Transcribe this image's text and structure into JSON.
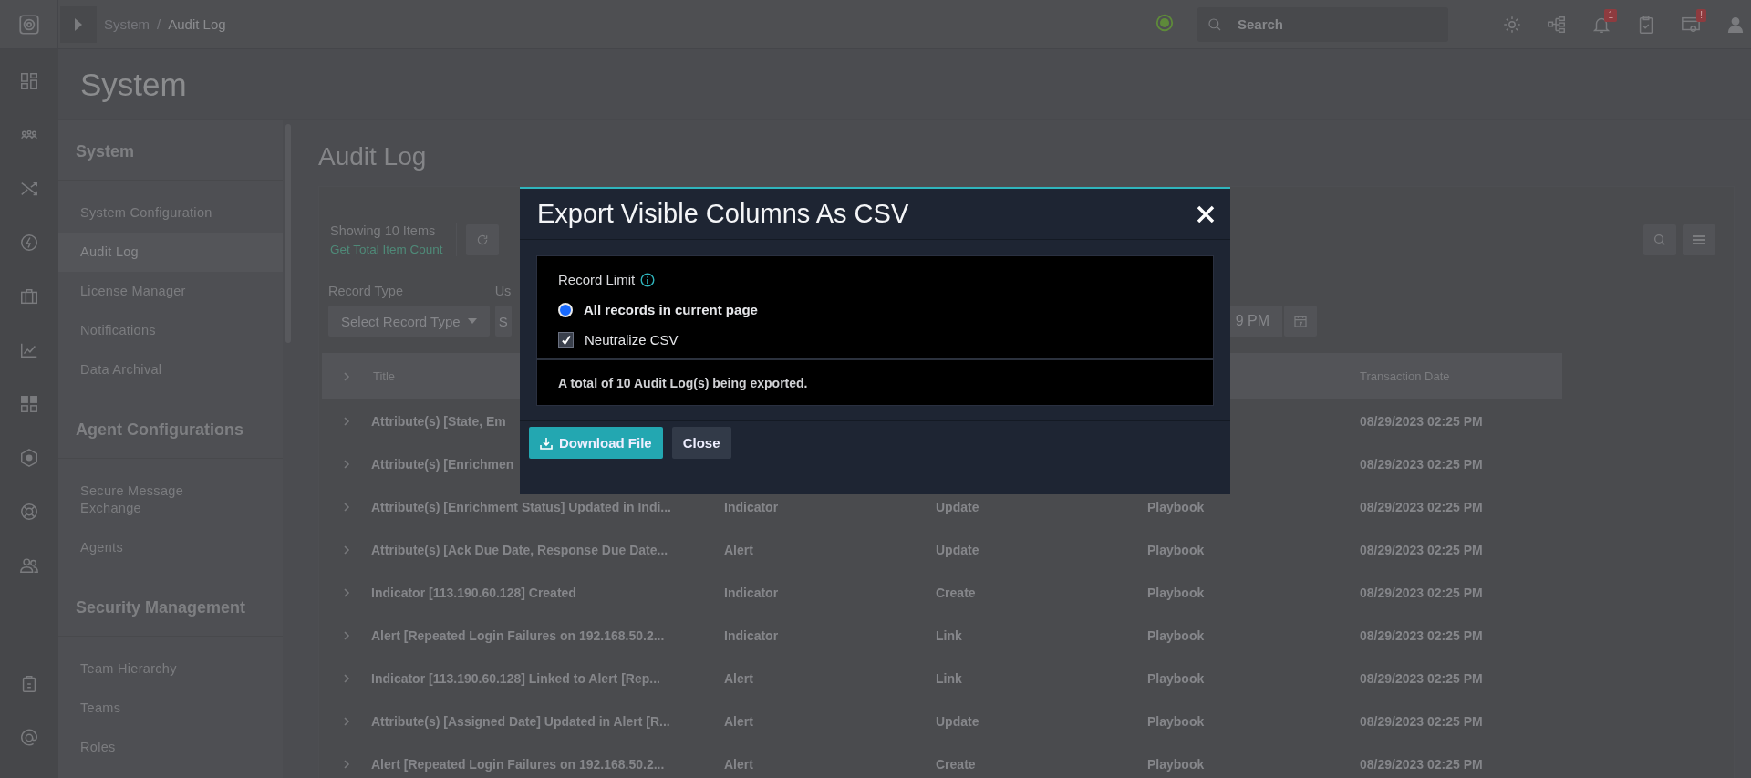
{
  "topbar": {
    "breadcrumb": [
      "System",
      "Audit Log"
    ],
    "breadcrumb_separator": "/",
    "search": {
      "placeholder": "Search"
    },
    "notification_badge": "1",
    "settings_badge": "!"
  },
  "page_title": "System",
  "sidebar": {
    "sections": [
      {
        "title": "System",
        "items": [
          {
            "label": "System Configuration",
            "selected": false
          },
          {
            "label": "Audit Log",
            "selected": true
          },
          {
            "label": "License Manager",
            "selected": false
          },
          {
            "label": "Notifications",
            "selected": false
          },
          {
            "label": "Data Archival",
            "selected": false
          }
        ]
      },
      {
        "title": "Agent Configurations",
        "items": [
          {
            "label": "Secure Message Exchange",
            "selected": false
          },
          {
            "label": "Agents",
            "selected": false
          }
        ]
      },
      {
        "title": "Security Management",
        "items": [
          {
            "label": "Team Hierarchy",
            "selected": false
          },
          {
            "label": "Teams",
            "selected": false
          },
          {
            "label": "Roles",
            "selected": false
          }
        ]
      }
    ]
  },
  "content": {
    "title": "Audit Log",
    "showing": "Showing 10 Items",
    "total_link": "Get Total Item Count",
    "filters": [
      {
        "label": "Record Type",
        "value": "Select Record Type"
      },
      {
        "label": "Us",
        "value": "S"
      }
    ],
    "date_field": {
      "value": "9 PM"
    },
    "table": {
      "columns": [
        "Title",
        null,
        null,
        null,
        "Transaction Date"
      ],
      "rows": [
        {
          "cells": [
            "Attribute(s) [State, Em",
            null,
            null,
            null,
            "08/29/2023 02:25 PM"
          ]
        },
        {
          "cells": [
            "Attribute(s) [Enrichmen",
            null,
            null,
            null,
            "08/29/2023 02:25 PM"
          ]
        },
        {
          "cells": [
            "Attribute(s) [Enrichment Status] Updated in Indi...",
            "Indicator",
            "Update",
            "Playbook",
            "08/29/2023 02:25 PM"
          ]
        },
        {
          "cells": [
            "Attribute(s) [Ack Due Date, Response Due Date...",
            "Alert",
            "Update",
            "Playbook",
            "08/29/2023 02:25 PM"
          ]
        },
        {
          "cells": [
            "Indicator [113.190.60.128] Created",
            "Indicator",
            "Create",
            "Playbook",
            "08/29/2023 02:25 PM"
          ]
        },
        {
          "cells": [
            "Alert [Repeated Login Failures on 192.168.50.2...",
            "Indicator",
            "Link",
            "Playbook",
            "08/29/2023 02:25 PM"
          ]
        },
        {
          "cells": [
            "Indicator [113.190.60.128] Linked to Alert [Rep...",
            "Alert",
            "Link",
            "Playbook",
            "08/29/2023 02:25 PM"
          ]
        },
        {
          "cells": [
            "Attribute(s) [Assigned Date] Updated in Alert [R...",
            "Alert",
            "Update",
            "Playbook",
            "08/29/2023 02:25 PM"
          ]
        },
        {
          "cells": [
            "Alert [Repeated Login Failures on 192.168.50.2...",
            "Alert",
            "Create",
            "Playbook",
            "08/29/2023 02:25 PM"
          ]
        }
      ]
    }
  },
  "modal": {
    "title": "Export Visible Columns As CSV",
    "record_limit_label": "Record Limit",
    "radio": {
      "label": "All records in current page",
      "selected": true
    },
    "checkbox": {
      "label": "Neutralize CSV",
      "checked": true
    },
    "summary": "A total of 10 Audit Log(s) being exported.",
    "buttons": [
      {
        "label": "Download File",
        "kind": "primary"
      },
      {
        "label": "Close",
        "kind": "secondary"
      }
    ]
  }
}
